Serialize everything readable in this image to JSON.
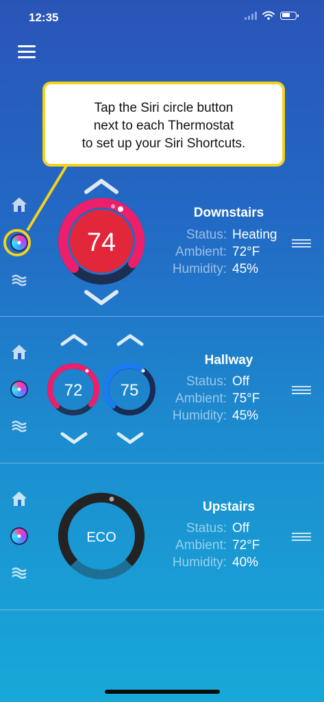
{
  "status_bar": {
    "time": "12:35"
  },
  "callout": {
    "lines": [
      "Tap the Siri circle button",
      "next to each Thermostat",
      "to set up your Siri Shortcuts."
    ]
  },
  "labels": {
    "status": "Status:",
    "ambient": "Ambient:",
    "humidity": "Humidity:"
  },
  "thermostats": [
    {
      "name": "Downstairs",
      "status": "Heating",
      "ambient": "72°F",
      "humidity": "45%",
      "setpoint": "74",
      "mode": "heat"
    },
    {
      "name": "Hallway",
      "status": "Off",
      "ambient": "75°F",
      "humidity": "45%",
      "heat_setpoint": "72",
      "cool_setpoint": "75",
      "mode": "heat-cool"
    },
    {
      "name": "Upstairs",
      "status": "Off",
      "ambient": "72°F",
      "humidity": "40%",
      "setpoint": "ECO",
      "mode": "eco"
    }
  ],
  "colors": {
    "callout_border": "#f5d21b",
    "heat": "#e8214f",
    "cool": "#1a7cf0",
    "eco_ring": "#222222"
  },
  "icons": [
    "hamburger-menu-icon",
    "home-icon",
    "siri-icon",
    "humidity-waves-icon",
    "chevron-up-icon",
    "chevron-down-icon",
    "reorder-handle-icon"
  ]
}
